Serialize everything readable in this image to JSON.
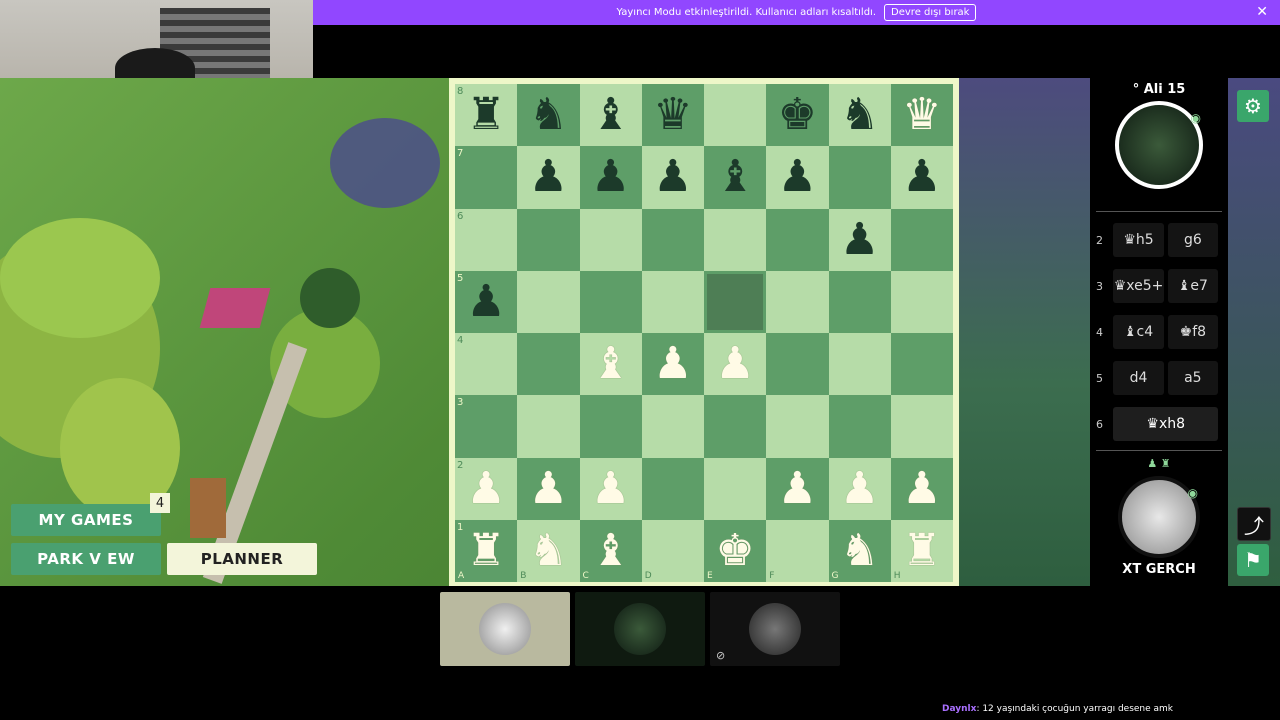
{
  "banner": {
    "message": "Yayıncı Modu etkinleştirildi. Kullanıcı adları kısaltıldı.",
    "button_label": "Devre dışı bırak",
    "close": "✕"
  },
  "board": {
    "ranks": [
      "8",
      "7",
      "6",
      "5",
      "4",
      "3",
      "2",
      "1"
    ],
    "files": [
      "A",
      "B",
      "C",
      "D",
      "E",
      "F",
      "G",
      "H"
    ],
    "position": [
      [
        "bR",
        "bN",
        "bB",
        "bQ",
        "",
        "bK",
        "bN",
        "wQ"
      ],
      [
        "",
        "bP",
        "bP",
        "bP",
        "bB",
        "bP",
        "",
        "bP"
      ],
      [
        "",
        "",
        "",
        "",
        "",
        "",
        "bP",
        ""
      ],
      [
        "bP",
        "",
        "",
        "",
        "hl",
        "",
        "",
        ""
      ],
      [
        "",
        "",
        "wB",
        "wP",
        "wP",
        "",
        "",
        ""
      ],
      [
        "",
        "",
        "",
        "",
        "",
        "",
        "",
        ""
      ],
      [
        "wP",
        "wP",
        "wP",
        "",
        "",
        "wP",
        "wP",
        "wP"
      ],
      [
        "wR",
        "wN",
        "wB",
        "",
        "wK",
        "",
        "wN",
        "wR"
      ]
    ]
  },
  "top_player": {
    "name": "° Ali 15",
    "eye_icon": "eye-icon"
  },
  "moves": [
    {
      "num": "2",
      "white": "♛h5",
      "black": "g6"
    },
    {
      "num": "3",
      "white": "♛xe5+",
      "black": "♝e7"
    },
    {
      "num": "4",
      "white": "♝c4",
      "black": "♚f8"
    },
    {
      "num": "5",
      "white": "d4",
      "black": "a5"
    },
    {
      "num": "6",
      "white": "♛xh8",
      "black": ""
    }
  ],
  "captured": "♟ ♜",
  "bottom_player": {
    "name": "XT GERCH"
  },
  "menu": {
    "my_games": "MY GAMES",
    "my_games_count": "4",
    "park_view": "PARK V EW",
    "planner": "PLANNER"
  },
  "chat": {
    "user": "Daynlx",
    "message": ": 12 yaşındaki çocuğun yarragı desene amk"
  },
  "colors": {
    "light_square": "#b6dca8",
    "dark_square": "#5e9e68",
    "accent_green": "#3aa66b",
    "banner_purple": "#9147ff"
  }
}
